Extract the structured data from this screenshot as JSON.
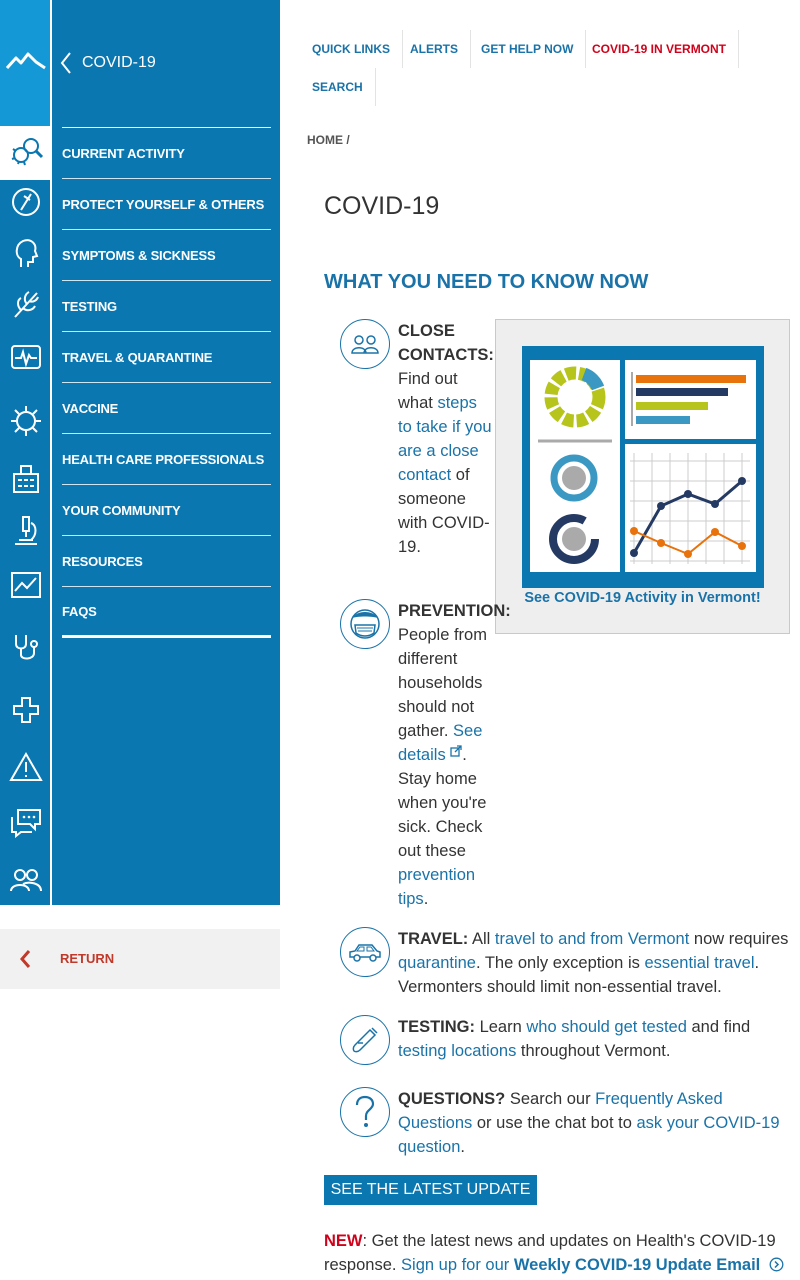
{
  "sidebar": {
    "title": "COVID-19",
    "items": [
      {
        "label": "CURRENT ACTIVITY",
        "icon": "virus-magnifier-icon"
      },
      {
        "label": "PROTECT YOURSELF & OTHERS",
        "icon": "shield-person-icon"
      },
      {
        "label": "SYMPTOMS & SICKNESS",
        "icon": "head-profile-icon"
      },
      {
        "label": "TESTING",
        "icon": "leaf-icon"
      },
      {
        "label": "TRAVEL & QUARANTINE",
        "icon": "heart-monitor-icon"
      },
      {
        "label": "VACCINE",
        "icon": "virus-icon"
      },
      {
        "label": "HEALTH CARE PROFESSIONALS",
        "icon": "building-icon"
      },
      {
        "label": "YOUR COMMUNITY",
        "icon": "microscope-icon"
      },
      {
        "label": "RESOURCES",
        "icon": "chart-icon"
      },
      {
        "label": "FAQS",
        "icon": "stethoscope-icon"
      }
    ],
    "rail_extra_icons": [
      "plus-icon",
      "warning-icon",
      "chat-icon",
      "people-icon"
    ],
    "return_label": "RETURN"
  },
  "toplinks": [
    {
      "label": "QUICK LINKS"
    },
    {
      "label": "ALERTS"
    },
    {
      "label": "GET HELP NOW"
    },
    {
      "label": "COVID-19 IN VERMONT"
    },
    {
      "label": "SEARCH"
    }
  ],
  "breadcrumb": {
    "home": "HOME",
    "sep": "/"
  },
  "page_title": "COVID-19",
  "section_title": "WHAT YOU NEED TO KNOW NOW",
  "activity_card": {
    "link": "See COVID-19 Activity in Vermont!"
  },
  "items": {
    "close_contacts": {
      "label": "CLOSE CONTACTS:",
      "t1": "Find out what ",
      "link1": "steps to take if you are a close contact",
      "t2": " of someone with COVID-19."
    },
    "prevention": {
      "label": "PREVENTION:",
      "t1": "People from different households should not gather. ",
      "link1": "See details",
      "t2": ". Stay home when you're sick. Check out these ",
      "link2": "prevention tips",
      "t3": "."
    },
    "travel": {
      "label": "TRAVEL:",
      "t1": " All ",
      "link1": "travel to and from Vermont",
      "t2": " now requires ",
      "link2": "quarantine",
      "t3": ". The only exception is ",
      "link3": "essential travel",
      "t4": ". Vermonters should limit non-essential travel."
    },
    "testing": {
      "label": "TESTING:",
      "t1": " Learn ",
      "link1": "who should get tested",
      "t2": " and find ",
      "link2": "testing locations",
      "t3": " throughout Vermont."
    },
    "questions": {
      "label": "QUESTIONS?",
      "t1": " Search our ",
      "link1": "Frequently Asked Questions",
      "t2": " or use the chat bot to ",
      "link2": "ask your COVID-19 question",
      "t3": "."
    }
  },
  "latest_button": "SEE THE LATEST UPDATE",
  "news": {
    "new": "NEW",
    "t1": ": Get the latest news and updates on Health's COVID-19 response. ",
    "link1": "Sign up for our ",
    "link2": "Weekly COVID-19 Update Email"
  },
  "colors": {
    "primary": "#0a77b1",
    "rail_top": "#1599d6",
    "link": "#1a73a8",
    "alert_red": "#d0021b"
  }
}
